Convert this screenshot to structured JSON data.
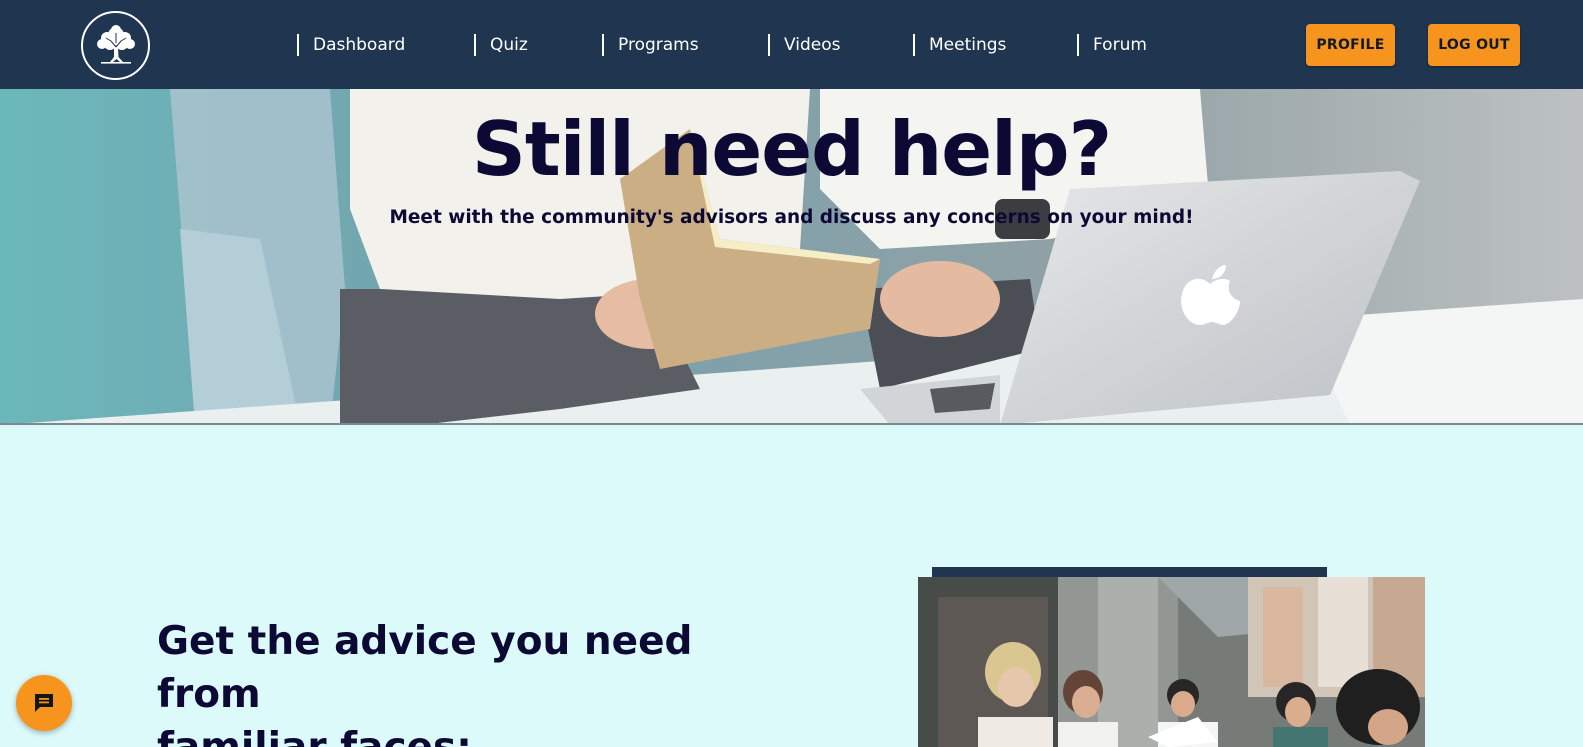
{
  "nav": {
    "items": [
      {
        "label": "Dashboard"
      },
      {
        "label": "Quiz"
      },
      {
        "label": "Programs"
      },
      {
        "label": "Videos"
      },
      {
        "label": "Meetings"
      },
      {
        "label": "Forum"
      }
    ],
    "profile_label": "PROFILE",
    "logout_label": "LOG OUT"
  },
  "hero": {
    "title": "Still need help?",
    "subtitle": "Meet with the community's advisors and discuss any concerns on your mind!"
  },
  "section": {
    "heading_line1": "Get the advice you need from",
    "heading_line2": "familiar faces:"
  },
  "colors": {
    "nav_bg": "#1f3550",
    "accent": "#f7941d",
    "page_bg": "#dcfafa",
    "heading": "#0c0a35"
  },
  "icons": {
    "logo": "tree-logo-icon",
    "chat": "chat-bubble-icon"
  }
}
